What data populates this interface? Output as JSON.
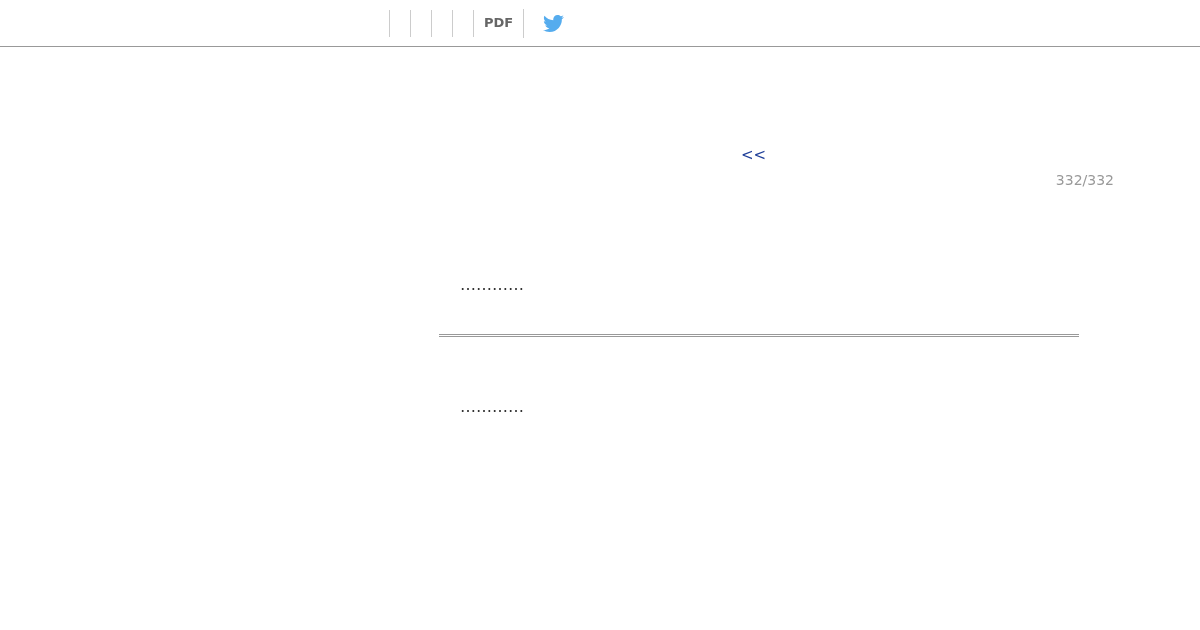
{
  "toolbar": {
    "pdf_link": "PDF"
  },
  "pager": {
    "back_link": "<<",
    "page_count": "332/332"
  },
  "sections": [
    {
      "text": "…………"
    },
    {
      "text": "…………"
    }
  ]
}
